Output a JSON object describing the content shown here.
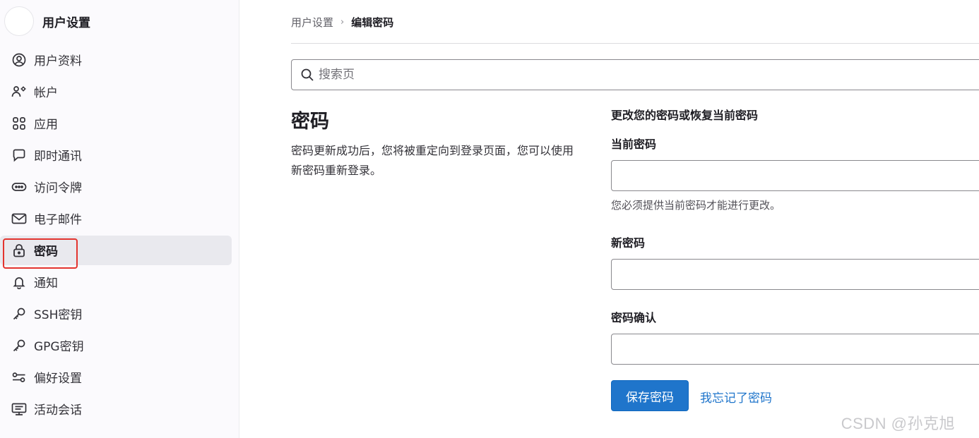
{
  "sidebar": {
    "title": "用户设置",
    "items": [
      {
        "label": "用户资料",
        "icon": "profile-icon"
      },
      {
        "label": "帐户",
        "icon": "account-icon"
      },
      {
        "label": "应用",
        "icon": "applications-icon"
      },
      {
        "label": "即时通讯",
        "icon": "chat-icon"
      },
      {
        "label": "访问令牌",
        "icon": "token-icon"
      },
      {
        "label": "电子邮件",
        "icon": "mail-icon"
      },
      {
        "label": "密码",
        "icon": "lock-icon",
        "active": true
      },
      {
        "label": "通知",
        "icon": "bell-icon"
      },
      {
        "label": "SSH密钥",
        "icon": "key-icon"
      },
      {
        "label": "GPG密钥",
        "icon": "key-icon"
      },
      {
        "label": "偏好设置",
        "icon": "preferences-icon"
      },
      {
        "label": "活动会话",
        "icon": "monitor-icon"
      }
    ]
  },
  "breadcrumb": {
    "parent": "用户设置",
    "current": "编辑密码"
  },
  "search": {
    "placeholder": "搜索页"
  },
  "section": {
    "title": "密码",
    "description": "密码更新成功后，您将被重定向到登录页面，您可以使用新密码重新登录。"
  },
  "form": {
    "heading": "更改您的密码或恢复当前密码",
    "current_password": {
      "label": "当前密码",
      "value": "",
      "help": "您必须提供当前密码才能进行更改。"
    },
    "new_password": {
      "label": "新密码",
      "value": ""
    },
    "confirm_password": {
      "label": "密码确认",
      "value": ""
    },
    "save_label": "保存密码",
    "forgot_label": "我忘记了密码"
  },
  "watermark": "CSDN @孙克旭",
  "colors": {
    "primary": "#1f75cb",
    "highlight": "#e3342f",
    "active_bg": "#e9e9ee"
  }
}
